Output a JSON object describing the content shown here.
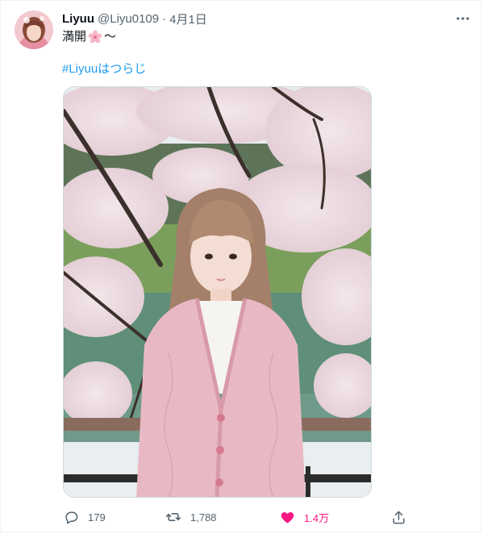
{
  "tweet": {
    "display_name": "Liyuu",
    "handle": "@Liyu0109",
    "separator": "·",
    "date": "4月1日",
    "text": "満開",
    "text_suffix": "～",
    "text_emoji": "cherry-blossom",
    "hashtag": "#Liyuuはつらじ",
    "image": "photo of a woman in a pink ruffled cardigan in front of cherry blossoms by a moat"
  },
  "actions": {
    "replies": "179",
    "retweets": "1,788",
    "likes": "1.4万",
    "liked": true
  },
  "colors": {
    "link": "#1d9bf0",
    "like": "#f91880",
    "muted": "#536471"
  }
}
